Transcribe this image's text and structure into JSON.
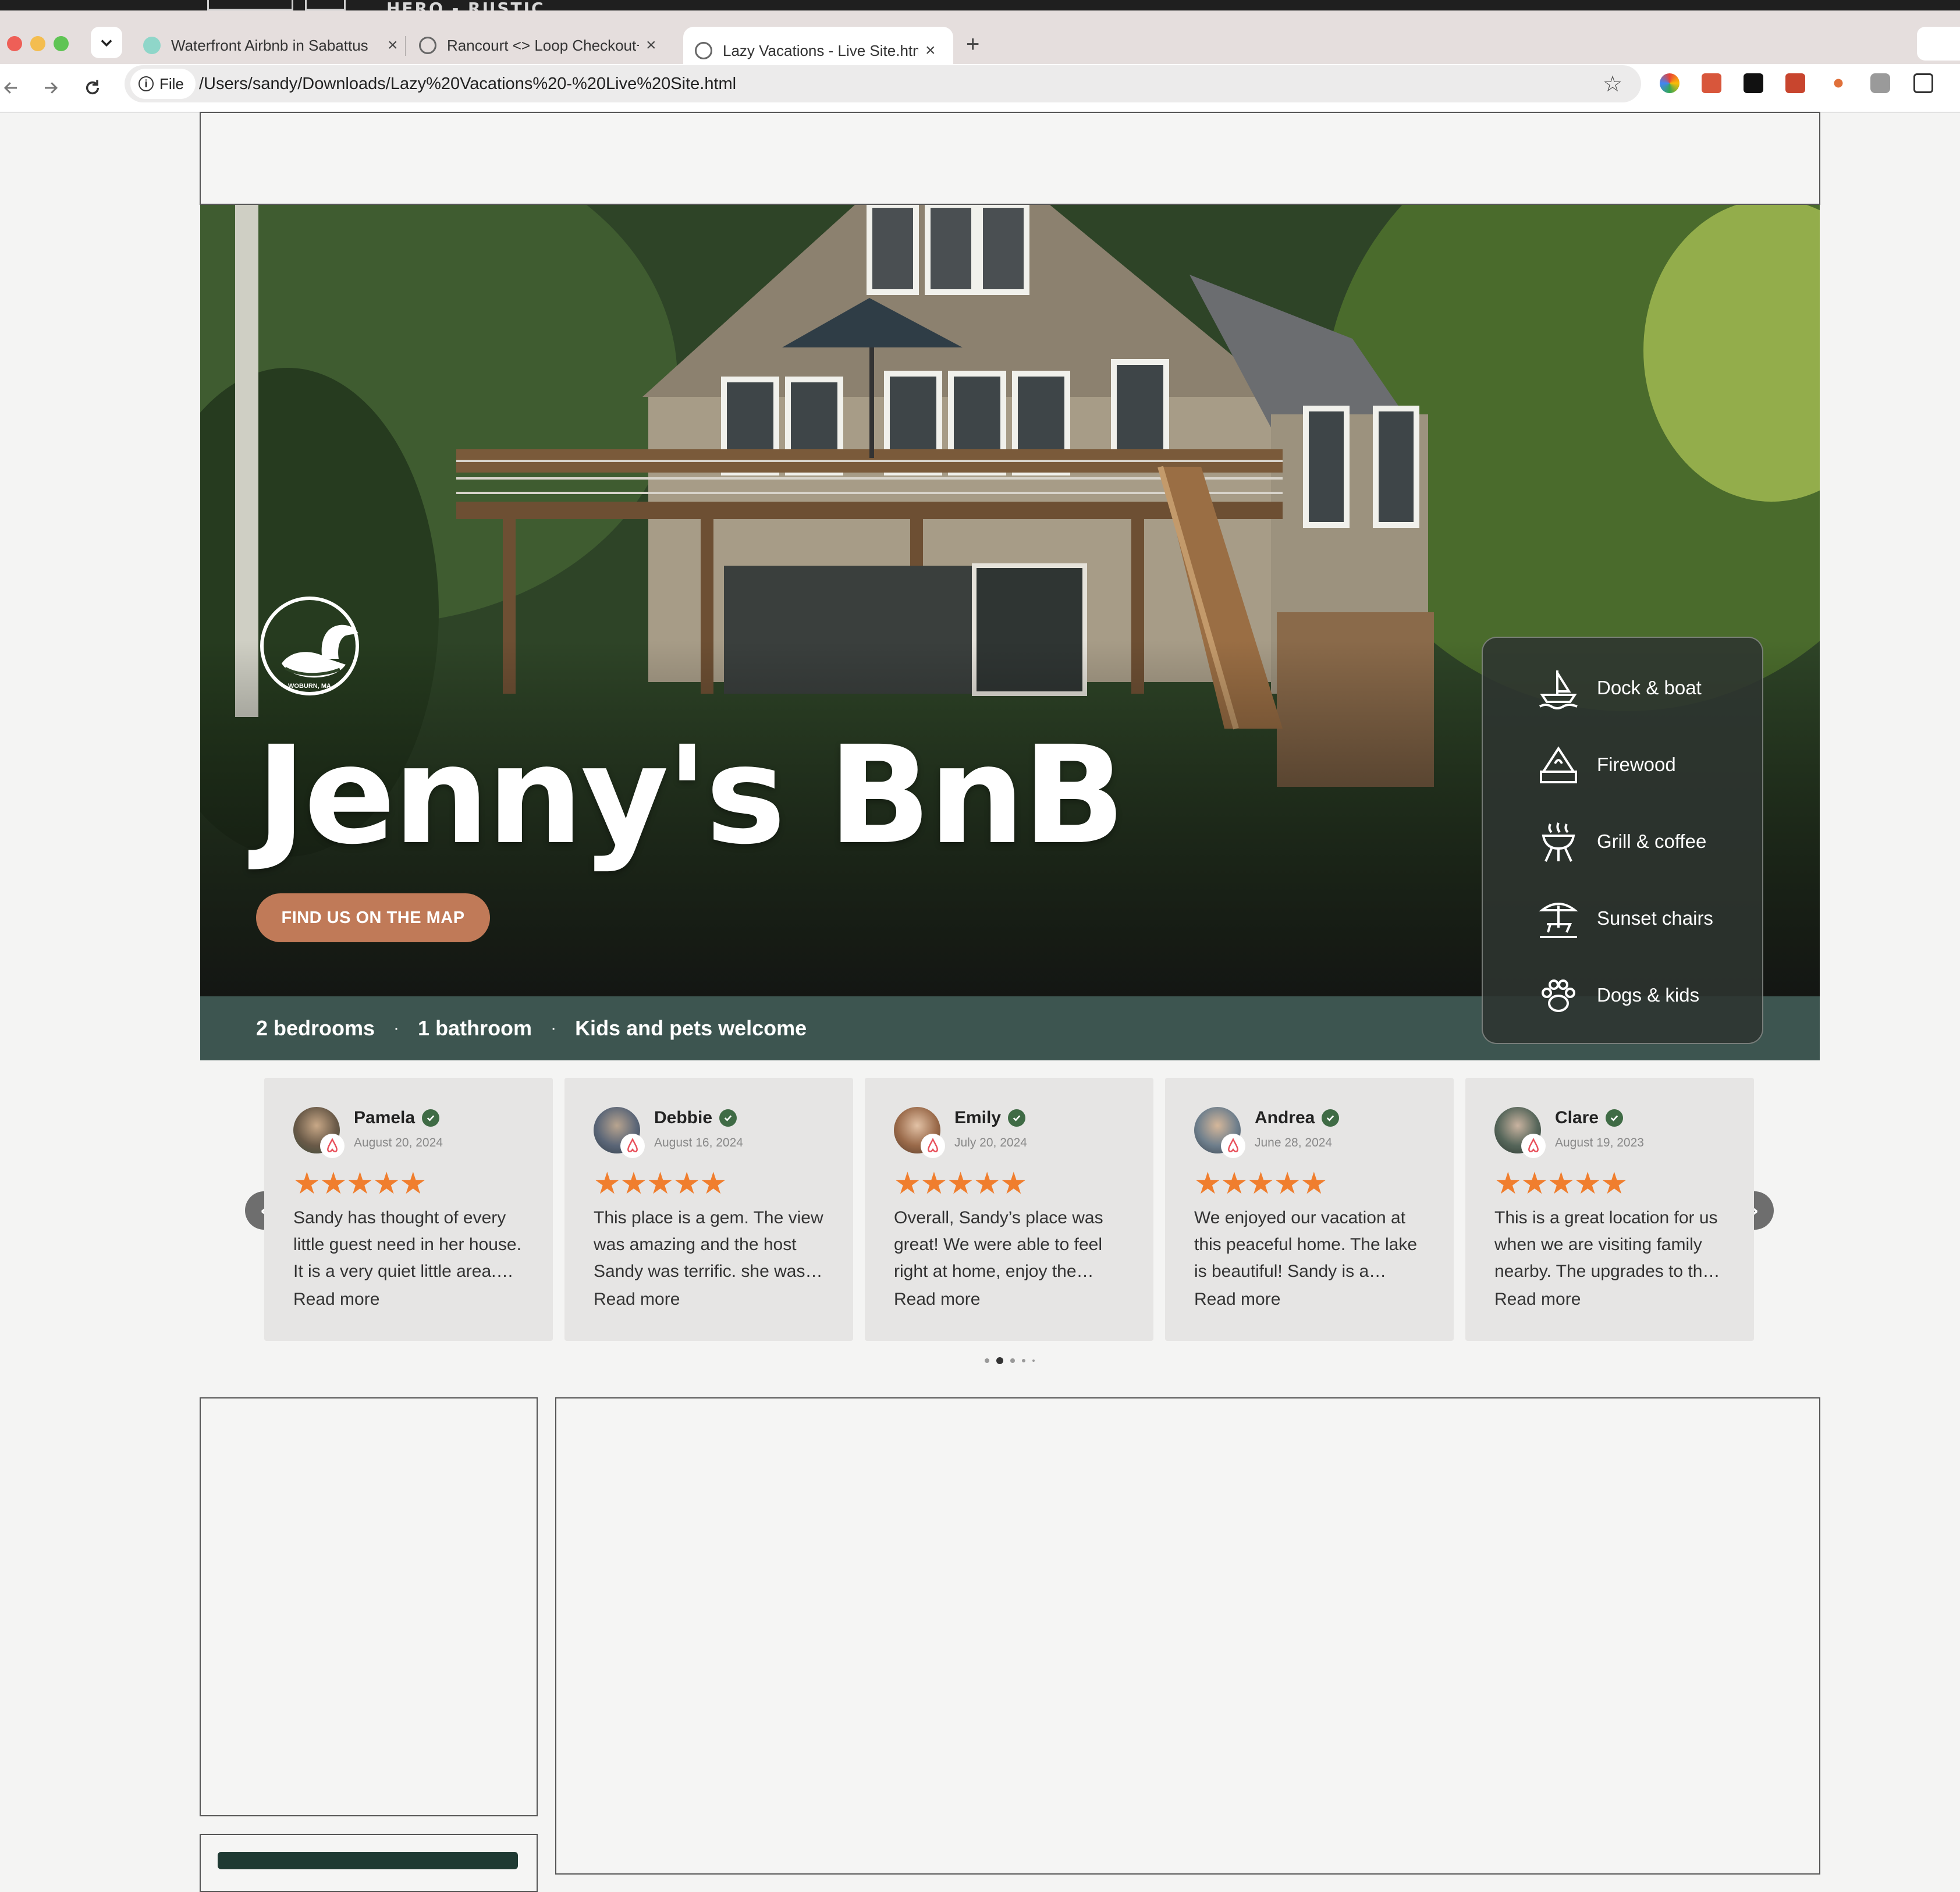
{
  "browser": {
    "background_tab_text": "HERO - RUSTIC",
    "tabs": [
      {
        "title": "Waterfront Airbnb in Sabattus",
        "close": "×"
      },
      {
        "title": "Rancourt <> Loop Checkout+",
        "close": "×"
      },
      {
        "title": "Lazy Vacations - Live Site.htm",
        "close": "×",
        "active": true
      }
    ],
    "new_tab": "+",
    "file_chip": "File",
    "url": "/Users/sandy/Downloads/Lazy%20Vacations%20-%20Live%20Site.html"
  },
  "hero": {
    "logo_text": "WOBURN, MA",
    "title": "Jenny's BnB",
    "map_button": "FIND US ON THE MAP",
    "stats": [
      "2 bedrooms",
      "1 bathroom",
      "Kids and pets welcome"
    ],
    "stat_separator": "·"
  },
  "amenities": [
    {
      "icon": "boat-icon",
      "label": "Dock & boat"
    },
    {
      "icon": "firewood-icon",
      "label": "Firewood"
    },
    {
      "icon": "grill-icon",
      "label": "Grill & coffee"
    },
    {
      "icon": "beach-chair-icon",
      "label": "Sunset chairs"
    },
    {
      "icon": "paw-icon",
      "label": "Dogs & kids"
    }
  ],
  "reviews": {
    "items": [
      {
        "name": "Pamela",
        "date": "August 20, 2024",
        "rating": 5,
        "text": "Sandy has thought of every little guest need in her house. It is a very quiet little area.…",
        "more": "Read more"
      },
      {
        "name": "Debbie",
        "date": "August 16, 2024",
        "rating": 5,
        "text": "This place is a gem. The view was amazing and the host Sandy was terrific. she was…",
        "more": "Read more"
      },
      {
        "name": "Emily",
        "date": "July 20, 2024",
        "rating": 5,
        "text": "Overall, Sandy’s place was great! We were able to feel right at home, enjoy the…",
        "more": "Read more"
      },
      {
        "name": "Andrea",
        "date": "June 28, 2024",
        "rating": 5,
        "text": "We enjoyed our vacation at this peaceful home. The lake is beautiful! Sandy is a…",
        "more": "Read more"
      },
      {
        "name": "Clare",
        "date": "August 19, 2023",
        "rating": 5,
        "text": "This is a great location for us when we are visiting family nearby. The upgrades to th…",
        "more": "Read more"
      }
    ],
    "prev": "‹",
    "next": "›",
    "pages": 5,
    "active_page": 2,
    "star_color": "#f07e2e"
  },
  "colors": {
    "accent_button": "#c07a58",
    "stats_bar": "#3d5550",
    "verified_badge": "#3f6b45"
  }
}
